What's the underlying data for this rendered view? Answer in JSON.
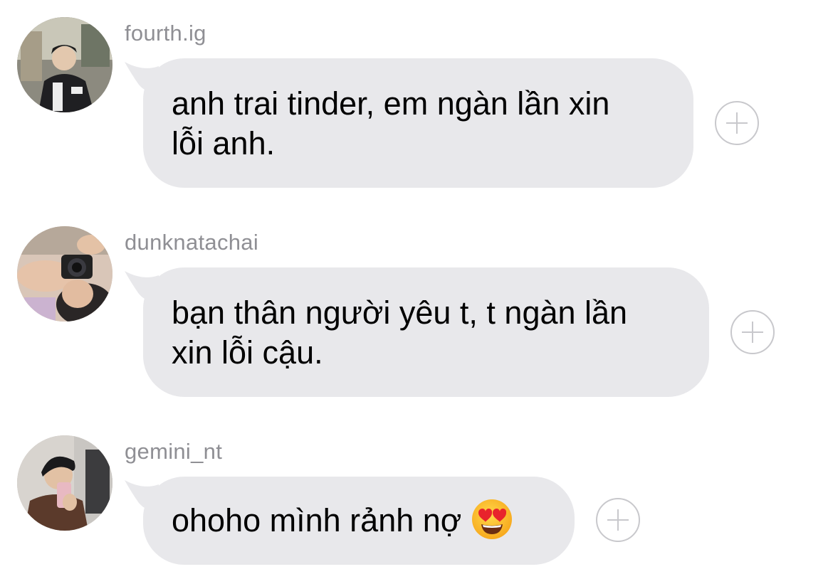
{
  "messages": [
    {
      "username": "fourth.ig",
      "text_line1": "anh trai tinder, em ngàn lần xin",
      "text_line2": "lỗi anh."
    },
    {
      "username": "dunknatachai",
      "text_line1": "bạn thân người yêu t, t ngàn lần",
      "text_line2": "xin lỗi cậu."
    },
    {
      "username": "gemini_nt",
      "text_line1": "ohoho mình rảnh nợ",
      "emoji": "smiling-face-with-heart-eyes"
    }
  ],
  "colors": {
    "bubble": "#e8e8eb",
    "username": "#8f8f94",
    "plus": "#c8c8cc"
  }
}
